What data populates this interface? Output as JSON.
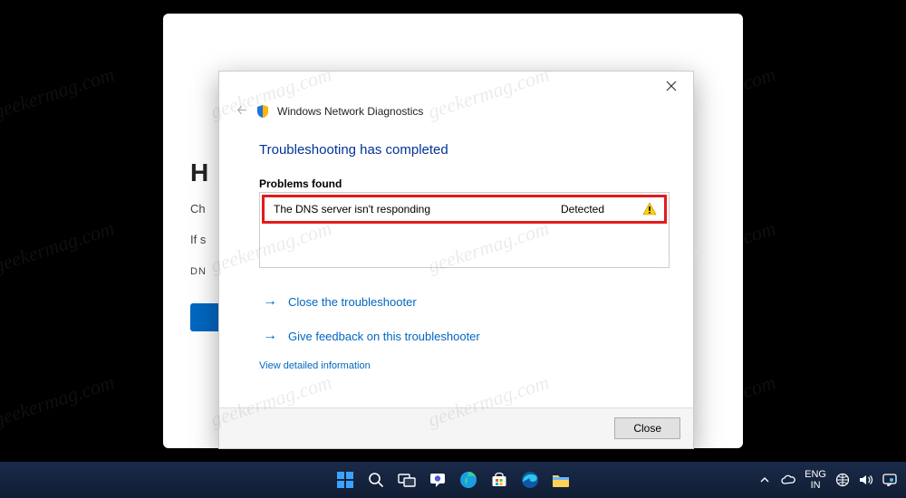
{
  "watermark_text": "geekermag.com",
  "background_window": {
    "heading_prefix": "H",
    "line1_prefix": "Ch",
    "line2_prefix": "If s",
    "label_prefix": "DN"
  },
  "dialog": {
    "title": "Windows Network Diagnostics",
    "headline": "Troubleshooting has completed",
    "problems_label": "Problems found",
    "problems": [
      {
        "name": "The DNS server isn't responding",
        "status": "Detected"
      }
    ],
    "actions": {
      "close_troubleshooter": "Close the troubleshooter",
      "give_feedback": "Give feedback on this troubleshooter"
    },
    "detail_link": "View detailed information",
    "close_button": "Close"
  },
  "taskbar": {
    "lang_top": "ENG",
    "lang_bottom": "IN"
  }
}
